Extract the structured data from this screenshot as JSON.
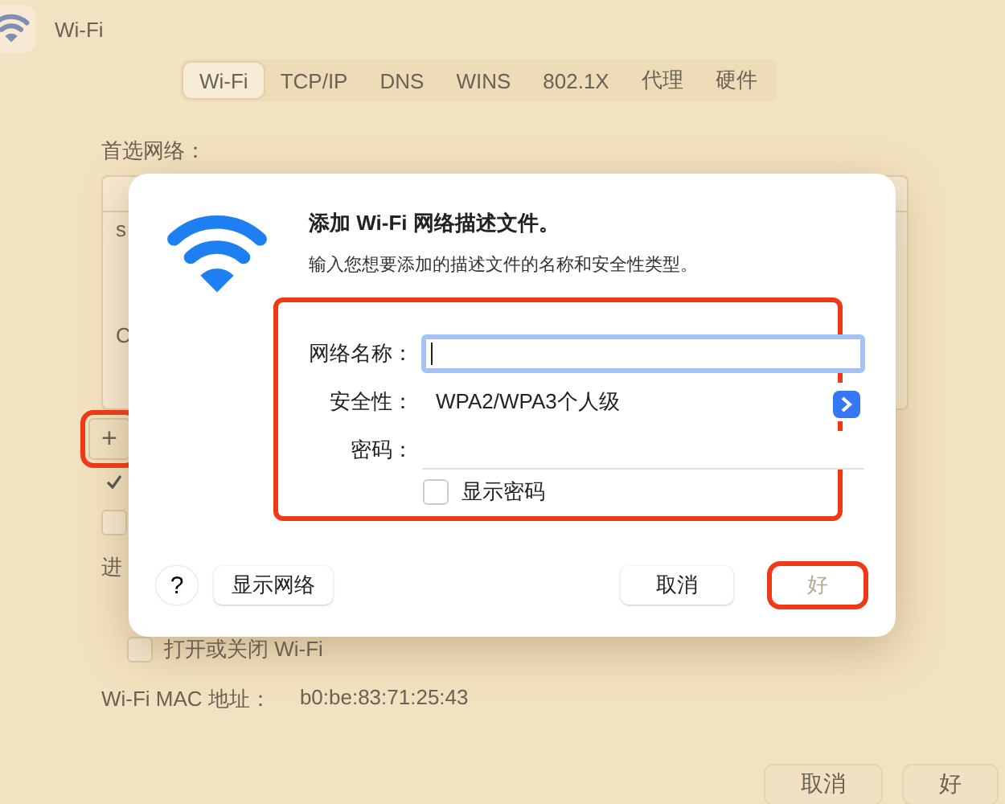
{
  "window": {
    "title": "Wi-Fi"
  },
  "tabs": [
    {
      "label": "Wi-Fi",
      "selected": true
    },
    {
      "label": "TCP/IP",
      "selected": false
    },
    {
      "label": "DNS",
      "selected": false
    },
    {
      "label": "WINS",
      "selected": false
    },
    {
      "label": "802.1X",
      "selected": false
    },
    {
      "label": "代理",
      "selected": false
    },
    {
      "label": "硬件",
      "selected": false
    }
  ],
  "preferred_networks": {
    "label": "首选网络：",
    "rows": [
      "s",
      "C"
    ],
    "add_button": {
      "label": "+",
      "highlighted": true
    }
  },
  "options": [
    {
      "checked": true
    },
    {
      "checked": false
    }
  ],
  "section_label": "进",
  "wifi_toggle": {
    "label": "打开或关闭 Wi-Fi",
    "checked": false
  },
  "mac": {
    "label": "Wi-Fi MAC 地址：",
    "value": "b0:be:83:71:25:43"
  },
  "footer": {
    "buttons": [
      {
        "label": "取消",
        "disabled": false
      },
      {
        "label": "好",
        "disabled": false
      }
    ]
  },
  "dialog": {
    "title": "添加 Wi-Fi 网络描述文件。",
    "subtitle": "输入您想要添加的描述文件的名称和安全性类型。",
    "form_highlighted": true,
    "fields": [
      {
        "kind": "text",
        "label": "网络名称：",
        "focused": true
      },
      {
        "kind": "select",
        "label": "安全性：",
        "value": "WPA2/WPA3个人级"
      },
      {
        "kind": "password",
        "label": "密码："
      }
    ],
    "show_password": {
      "label": "显示密码",
      "checked": false
    },
    "help": "?",
    "show_networks": "显示网络",
    "buttons": [
      {
        "label": "取消",
        "disabled": false,
        "highlighted": false
      },
      {
        "label": "好",
        "disabled": true,
        "highlighted": true
      }
    ]
  }
}
